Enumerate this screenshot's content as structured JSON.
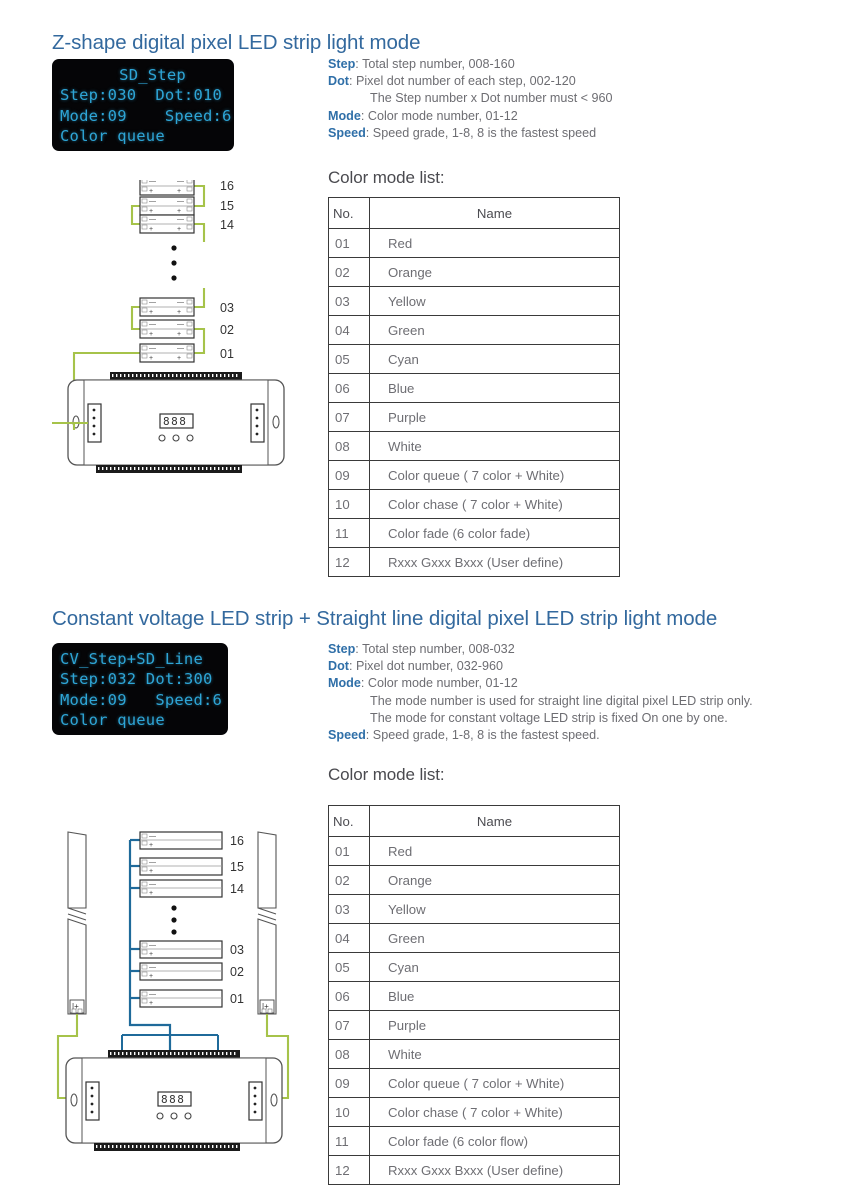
{
  "colors": {
    "heading": "#33699e",
    "key_label": "#2f6fa8",
    "body_text": "#6d6d72",
    "lcd_bg": "#050507",
    "lcd_text": "#2ea5d6",
    "wire_green": "#a6c34a",
    "wire_blue": "#1f6a9a",
    "table_border": "#3a3a3a"
  },
  "sections": [
    {
      "heading": "Z-shape digital pixel LED strip light mode",
      "lcd": {
        "line1": "  SD_Step",
        "line2": "Step:030  Dot:010",
        "line3": "Mode:09    Speed:6",
        "line4": "Color queue"
      },
      "specs": [
        {
          "key": "Step",
          "sep": ":",
          "text": " Total step number, 008-160",
          "indent": false
        },
        {
          "key": "Dot",
          "sep": ":",
          "text": "   Pixel dot number of each step, 002-120",
          "indent": false
        },
        {
          "key": "",
          "sep": "",
          "text": "The Step number x Dot number must < 960",
          "indent": true
        },
        {
          "key": "Mode",
          "sep": ":",
          "text": " Color mode number, 01-12",
          "indent": false
        },
        {
          "key": "Speed",
          "sep": ":",
          "text": " Speed grade, 1-8, 8 is the fastest speed",
          "indent": false
        }
      ],
      "color_mode_label": "Color mode list:",
      "table": {
        "headers": [
          "No.",
          "Name"
        ],
        "rows": [
          [
            "01",
            "Red"
          ],
          [
            "02",
            "Orange"
          ],
          [
            "03",
            "Yellow"
          ],
          [
            "04",
            "Green"
          ],
          [
            "05",
            "Cyan"
          ],
          [
            "06",
            "Blue"
          ],
          [
            "07",
            "Purple"
          ],
          [
            "08",
            "White"
          ],
          [
            "09",
            "Color queue ( 7 color + White)"
          ],
          [
            "10",
            "Color chase ( 7 color + White)"
          ],
          [
            "11",
            "Color fade (6 color fade)"
          ],
          [
            "12",
            "Rxxx Gxxx Bxxx (User define)"
          ]
        ]
      },
      "diagram": {
        "strip_labels": [
          "16",
          "15",
          "14",
          "03",
          "02",
          "01"
        ],
        "ellipsis": "•",
        "controller_display": "888",
        "terminal_label": "0"
      }
    },
    {
      "heading": "Constant voltage LED strip + Straight line digital pixel LED strip light mode",
      "lcd": {
        "line1": "CV_Step+SD_Line",
        "line2": "Step:032 Dot:300",
        "line3": "Mode:09   Speed:6",
        "line4": "Color queue"
      },
      "specs": [
        {
          "key": "Step",
          "sep": ":",
          "text": " Total step number, 008-032",
          "indent": false
        },
        {
          "key": "Dot",
          "sep": ":",
          "text": "   Pixel dot number, 032-960",
          "indent": false
        },
        {
          "key": "Mode",
          "sep": ":",
          "text": " Color mode number, 01-12",
          "indent": false
        },
        {
          "key": "",
          "sep": "",
          "text": "The mode number is used for straight line digital pixel LED strip only.",
          "indent": true
        },
        {
          "key": "",
          "sep": "",
          "text": "The mode for constant voltage LED strip is fixed On one by one.",
          "indent": true
        },
        {
          "key": "Speed",
          "sep": ":",
          "text": " Speed grade, 1-8, 8 is the fastest speed.",
          "indent": false
        }
      ],
      "color_mode_label": "Color mode list:",
      "table": {
        "headers": [
          "No.",
          "Name"
        ],
        "rows": [
          [
            "01",
            "Red"
          ],
          [
            "02",
            "Orange"
          ],
          [
            "03",
            "Yellow"
          ],
          [
            "04",
            "Green"
          ],
          [
            "05",
            "Cyan"
          ],
          [
            "06",
            "Blue"
          ],
          [
            "07",
            "Purple"
          ],
          [
            "08",
            "White"
          ],
          [
            "09",
            "Color queue ( 7 color + White)"
          ],
          [
            "10",
            "Color chase ( 7 color + White)"
          ],
          [
            "11",
            "Color fade (6 color flow)"
          ],
          [
            "12",
            "Rxxx Gxxx Bxxx (User define)"
          ]
        ]
      },
      "diagram": {
        "strip_labels": [
          "16",
          "15",
          "14",
          "03",
          "02",
          "01"
        ],
        "ellipsis": "•",
        "controller_display": "888",
        "cv_terminal_left": "|+",
        "cv_terminal_right": "|+"
      }
    }
  ]
}
